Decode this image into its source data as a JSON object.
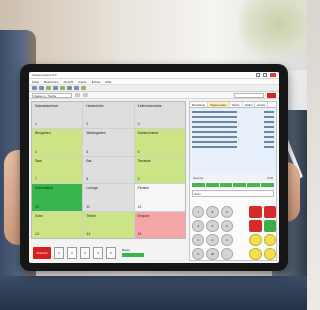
{
  "app": {
    "window_title": "Kassensystem 8.0",
    "menu": [
      "Datei",
      "Bearbeiten",
      "Ansicht",
      "Kasse",
      "Extras",
      "Hilfe"
    ],
    "address_field": "Kasse 1 - Tische"
  },
  "tables": [
    {
      "name": "Salzwiesenloch",
      "num": "1",
      "color": "grey"
    },
    {
      "name": "Hanseheim",
      "num": "2",
      "color": "grey"
    },
    {
      "name": "Kellerweinstube",
      "num": "3",
      "color": "grey"
    },
    {
      "name": "Biergarten",
      "num": "4",
      "color": "lime"
    },
    {
      "name": "Wintergarten",
      "num": "5",
      "color": "grey"
    },
    {
      "name": "Kaminzimmer",
      "num": "6",
      "color": "lime"
    },
    {
      "name": "Saal",
      "num": "7",
      "color": "lime"
    },
    {
      "name": "Bar",
      "num": "8",
      "color": "grey"
    },
    {
      "name": "Terrasse",
      "num": "9",
      "color": "lime"
    },
    {
      "name": "Stammtisch",
      "num": "10",
      "color": "green"
    },
    {
      "name": "Lounge",
      "num": "11",
      "color": "grey"
    },
    {
      "name": "Fenster",
      "num": "12",
      "color": "white"
    },
    {
      "name": "Ecke",
      "num": "13",
      "color": "lime"
    },
    {
      "name": "Theke",
      "num": "14",
      "color": "lime"
    },
    {
      "name": "Empore",
      "num": "15",
      "color": "pink"
    }
  ],
  "bottom_bar": {
    "exit_label": "Abbruch",
    "keys": [
      "1",
      "2",
      "3",
      "4",
      "5"
    ],
    "status_label": "Bereit"
  },
  "panel": {
    "tabs": [
      "Bestellung",
      "Tagesumsatz",
      "Tische",
      "Artikel",
      "Extras"
    ],
    "total_label": "Summe",
    "total_value": "0,00",
    "note_label": "Notiz"
  },
  "keypad": [
    {
      "label": "7",
      "style": "grey"
    },
    {
      "label": "8",
      "style": "grey"
    },
    {
      "label": "9",
      "style": "grey"
    },
    {
      "label": "",
      "style": "blank"
    },
    {
      "label": "",
      "style": "red"
    },
    {
      "label": "",
      "style": "red"
    },
    {
      "label": "4",
      "style": "grey"
    },
    {
      "label": "5",
      "style": "grey"
    },
    {
      "label": "6",
      "style": "grey"
    },
    {
      "label": "",
      "style": "blank"
    },
    {
      "label": "",
      "style": "red"
    },
    {
      "label": "",
      "style": "green"
    },
    {
      "label": "1",
      "style": "grey"
    },
    {
      "label": "2",
      "style": "grey"
    },
    {
      "label": "3",
      "style": "grey"
    },
    {
      "label": "",
      "style": "blank"
    },
    {
      "label": "",
      "style": "yellow"
    },
    {
      "label": "",
      "style": "yellow"
    },
    {
      "label": "0",
      "style": "grey"
    },
    {
      "label": "00",
      "style": "grey"
    },
    {
      "label": ",",
      "style": "grey"
    },
    {
      "label": "",
      "style": "blank"
    },
    {
      "label": "",
      "style": "yellow"
    },
    {
      "label": "",
      "style": "yellow"
    }
  ]
}
